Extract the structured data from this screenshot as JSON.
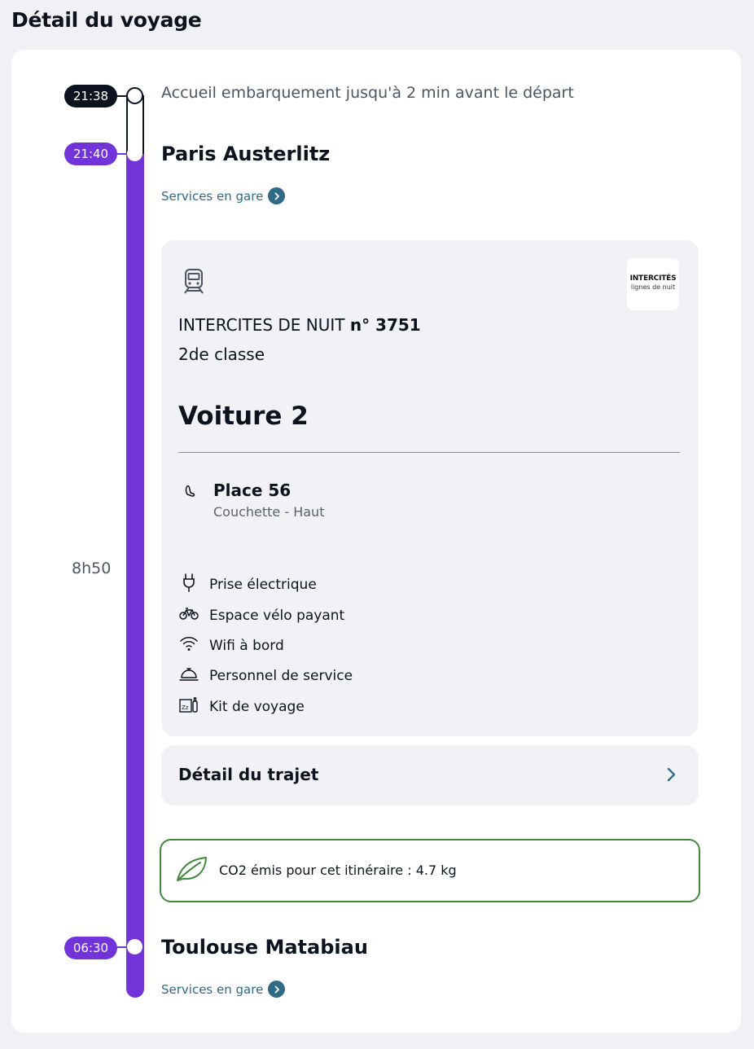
{
  "page": {
    "title": "Détail du voyage"
  },
  "timeline": {
    "boarding_time": "21:38",
    "boarding_text": "Accueil embarquement jusqu'à 2 min avant le départ",
    "departure_time": "21:40",
    "departure_station": "Paris Austerlitz",
    "departure_services": "Services en gare",
    "duration": "8h50",
    "arrival_time": "06:30",
    "arrival_station": "Toulouse Matabiau",
    "arrival_services": "Services en gare"
  },
  "train": {
    "icon": "train-icon",
    "name_prefix": "INTERCITES DE NUIT",
    "number": "n° 3751",
    "class": "2de classe",
    "coach": "Voiture 2",
    "operator_logo": {
      "main": "INTERCITÉS",
      "sub": "lignes de nuit"
    },
    "seat": {
      "icon": "seat-icon",
      "title": "Place 56",
      "subtitle": "Couchette - Haut"
    },
    "amenities": [
      {
        "icon": "plug-icon",
        "label": "Prise électrique"
      },
      {
        "icon": "bike-icon",
        "label": "Espace vélo payant"
      },
      {
        "icon": "wifi-icon",
        "label": "Wifi à bord"
      },
      {
        "icon": "service-bell-icon",
        "label": "Personnel de service"
      },
      {
        "icon": "travel-kit-icon",
        "label": "Kit de voyage"
      }
    ]
  },
  "detail_trajet": {
    "label": "Détail du trajet"
  },
  "co2": {
    "icon": "leaf-icon",
    "text": "CO2 émis pour cet itinéraire : 4.7 kg"
  },
  "colors": {
    "accent_purple": "#7234d9",
    "dark": "#0c131f",
    "link": "#2f6b86",
    "eco_green": "#3f8a3a",
    "panel": "#f2f2f6"
  }
}
